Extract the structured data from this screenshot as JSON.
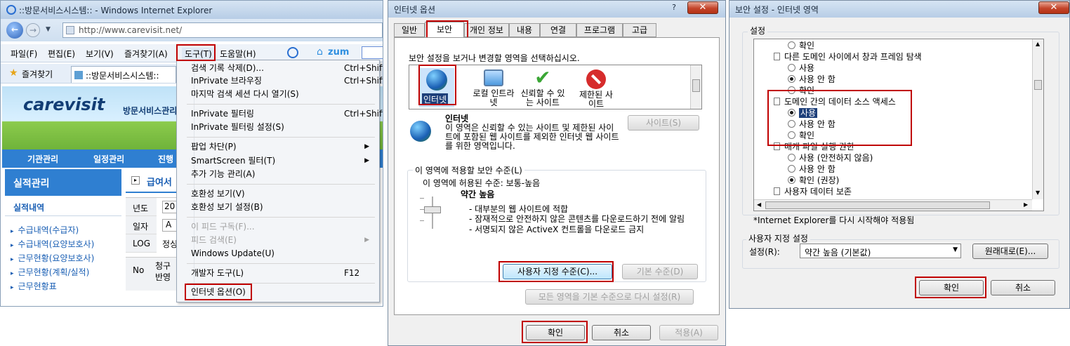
{
  "ie": {
    "title": "::방문서비스시스템:: - Windows Internet Explorer",
    "address": "http://www.carevisit.net/",
    "menubar": [
      "파일(F)",
      "편집(E)",
      "보기(V)",
      "즐겨찾기(A)",
      "도구(T)",
      "도움말(H)"
    ],
    "favorites_label": "즐겨찾기",
    "tab_label": "::방문서비스시스템::",
    "zum": "zum",
    "site": {
      "logo": "carevisit",
      "logo_sub": "방문서비스관리",
      "nav": [
        "기관관리",
        "일정관리",
        "진행"
      ],
      "left_title": "실적관리",
      "left_sub": "실적내역",
      "left_items": [
        "수급내역(수급자)",
        "수급내역(요양보호사)",
        "근무현황(요양보호사)",
        "근무현황(계획/실적)",
        "근무현황표"
      ],
      "main_title": "급여서",
      "row_labels": [
        "년도",
        "일자",
        "LOG"
      ],
      "row_values": [
        "20",
        "A",
        "정싱"
      ],
      "col_no": "No",
      "col_claim": "청구",
      "col_reflect": "반영"
    },
    "tools_menu": [
      {
        "label": "검색 기록 삭제(D)...",
        "key": "Ctrl+Shift+Del"
      },
      {
        "label": "InPrivate 브라우징",
        "key": "Ctrl+Shift+P"
      },
      {
        "label": "마지막 검색 세션 다시 열기(S)",
        "key": ""
      },
      {
        "label": "InPrivate 필터링",
        "key": "Ctrl+Shift+F"
      },
      {
        "label": "InPrivate 필터링 설정(S)",
        "key": ""
      },
      {
        "label": "팝업 차단(P)",
        "key": ""
      },
      {
        "label": "SmartScreen 필터(T)",
        "key": ""
      },
      {
        "label": "추가 기능 관리(A)",
        "key": ""
      },
      {
        "label": "호환성 보기(V)",
        "key": ""
      },
      {
        "label": "호환성 보기 설정(B)",
        "key": ""
      },
      {
        "label": "이 피드 구독(F)...",
        "key": ""
      },
      {
        "label": "피드 검색(E)",
        "key": ""
      },
      {
        "label": "Windows Update(U)",
        "key": ""
      },
      {
        "label": "개발자 도구(L)",
        "key": "F12"
      },
      {
        "label": "인터넷 옵션(O)",
        "key": ""
      }
    ]
  },
  "options": {
    "title": "인터넷 옵션",
    "tabs": [
      "일반",
      "보안",
      "개인 정보",
      "내용",
      "연결",
      "프로그램",
      "고급"
    ],
    "instruction": "보안 설정을 보거나 변경할 영역을 선택하십시오.",
    "zones": [
      "인터넷",
      "로컬 인트라넷",
      "신뢰할 수 있는 사이트",
      "제한된 사이트"
    ],
    "zone_name": "인터넷",
    "zone_desc": "이 영역은 신뢰할 수 있는 사이트 및 제한된 사이트에 포함된 웹 사이트를 제외한 인터넷 웹 사이트를 위한 영역입니다.",
    "sites_btn": "사이트(S)",
    "level_group": "이 영역에 적용할 보안 수준(L)",
    "allowed": "이 영역에 허용된 수준: 보통-높음",
    "level_name": "약간 높음",
    "bullets": [
      "- 대부분의 웹 사이트에 적합",
      "- 잠재적으로 안전하지 않은 콘텐츠를 다운로드하기 전에 알림",
      "- 서명되지 않은 ActiveX 컨트롤을 다운로드 금지"
    ],
    "custom_btn": "사용자 지정 수준(C)...",
    "default_btn": "기본 수준(D)",
    "reset_btn": "모든 영역을 기본 수준으로 다시 설정(R)",
    "ok": "확인",
    "cancel": "취소",
    "apply": "적용(A)"
  },
  "security": {
    "title": "보안 설정 - 인터넷 영역",
    "group": "설정",
    "items": [
      {
        "type": "radio",
        "label": "확인",
        "on": false
      },
      {
        "type": "head",
        "label": "다른 도메인 사이에서 창과 프레임 탐색"
      },
      {
        "type": "radio",
        "label": "사용",
        "on": false
      },
      {
        "type": "radio",
        "label": "사용 안 함",
        "on": true
      },
      {
        "type": "radio",
        "label": "확인",
        "on": false
      },
      {
        "type": "head",
        "label": "도메인 간의 데이터 소스 액세스"
      },
      {
        "type": "radio",
        "label": "사용",
        "on": true
      },
      {
        "type": "radio",
        "label": "사용 안 함",
        "on": false
      },
      {
        "type": "radio",
        "label": "확인",
        "on": false
      },
      {
        "type": "head",
        "label": "매개 파일 실행 권한"
      },
      {
        "type": "radio",
        "label": "사용 (안전하지 않음)",
        "on": false
      },
      {
        "type": "radio",
        "label": "사용 안 함",
        "on": false
      },
      {
        "type": "radio",
        "label": "확인 (권장)",
        "on": true
      },
      {
        "type": "head",
        "label": "사용자 데이터 보존"
      }
    ],
    "note": "*Internet Explorer를 다시 시작해야 적용됨",
    "custom_group": "사용자 지정 설정",
    "setting_label": "설정(R):",
    "setting_value": "약간 높음 (기본값)",
    "restore_btn": "원래대로(E)...",
    "ok": "확인",
    "cancel": "취소"
  }
}
